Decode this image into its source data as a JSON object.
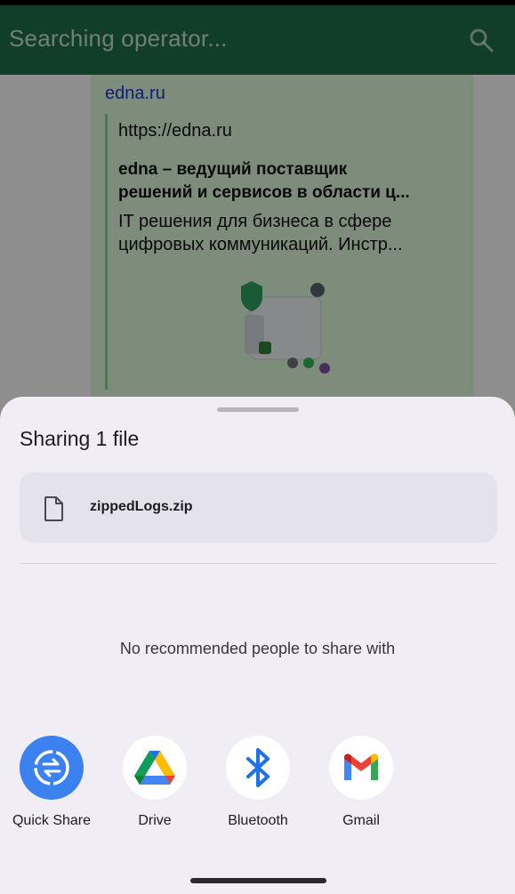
{
  "background_app": {
    "title": "Searching operator...",
    "message": {
      "link": "edna.ru",
      "preview_url": "https://edna.ru",
      "preview_title_line1": "edna – ведущий поставщик",
      "preview_title_line2": "решений и сервисов в области ц...",
      "preview_desc_line1": "IT решения для бизнеса в сфере",
      "preview_desc_line2": "цифровых коммуникаций. Инстр..."
    }
  },
  "share_sheet": {
    "title": "Sharing 1 file",
    "file": {
      "name": "zippedLogs.zip",
      "icon": "file-icon"
    },
    "no_recommendations": "No recommended people to share with",
    "targets": [
      {
        "label": "Quick Share",
        "icon": "quick-share-icon"
      },
      {
        "label": "Drive",
        "icon": "google-drive-icon"
      },
      {
        "label": "Bluetooth",
        "icon": "bluetooth-icon"
      },
      {
        "label": "Gmail",
        "icon": "gmail-icon"
      }
    ]
  },
  "colors": {
    "appbar": "#1e6b45",
    "bubble": "#d9f2d5",
    "sheet": "#f0eef4",
    "quick_share": "#3b82f0"
  }
}
